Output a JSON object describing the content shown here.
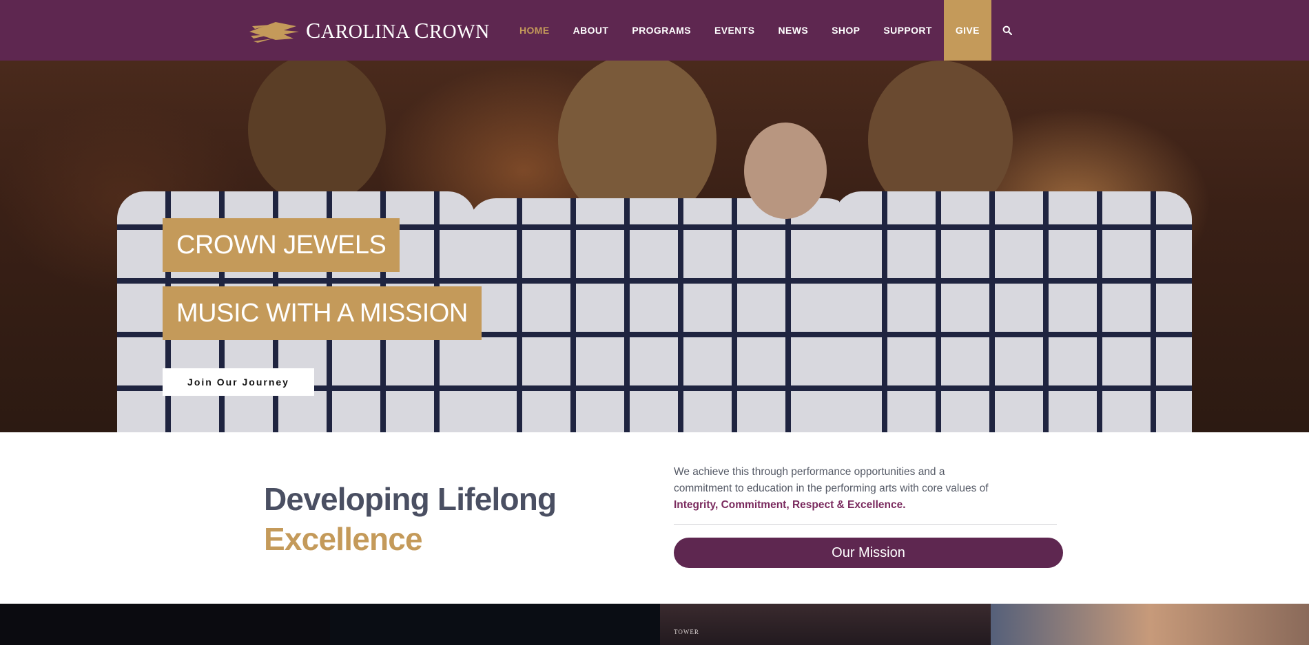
{
  "header": {
    "logo_text_a": "C",
    "logo_text_b": "AROLINA ",
    "logo_text_c": "C",
    "logo_text_d": "ROWN",
    "nav": [
      {
        "label": "HOME",
        "active": true
      },
      {
        "label": "ABOUT",
        "active": false
      },
      {
        "label": "PROGRAMS",
        "active": false
      },
      {
        "label": "EVENTS",
        "active": false
      },
      {
        "label": "NEWS",
        "active": false
      },
      {
        "label": "SHOP",
        "active": false
      },
      {
        "label": "SUPPORT",
        "active": false
      },
      {
        "label": "GIVE",
        "active": false
      }
    ],
    "search_icon": "search-icon"
  },
  "hero": {
    "tag1": "CROWN JEWELS",
    "tag2": "MUSIC WITH A MISSION",
    "button": "Join Our Journey"
  },
  "intro": {
    "heading_line1": "Developing Lifelong",
    "heading_line2": "Excellence",
    "text_lead": "We achieve this through performance opportunities and a commitment to education in the performing arts with core values of ",
    "text_values": "Integrity, Commitment, Respect & Excellence.",
    "button": "Our Mission"
  },
  "tiles": {
    "tile3_label": "TOWER"
  },
  "colors": {
    "purple": "#5e2750",
    "gold": "#c49a5a",
    "heading": "#4a4f62",
    "values": "#7a2a5e"
  }
}
